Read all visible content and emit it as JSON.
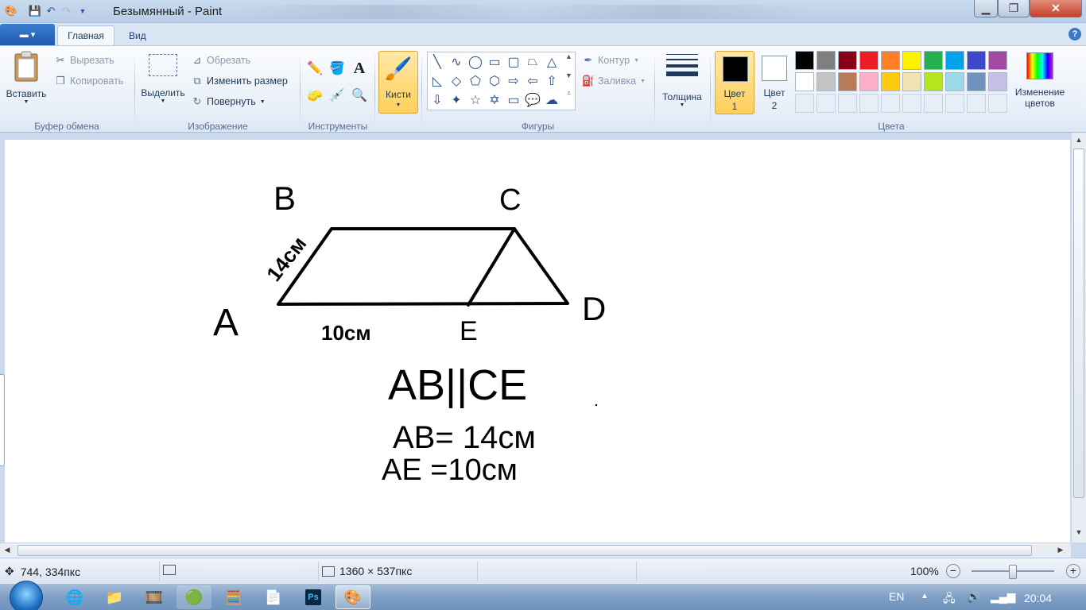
{
  "window": {
    "title": "Безымянный - Paint"
  },
  "tabs": [
    {
      "label": "Главная"
    },
    {
      "label": "Вид"
    }
  ],
  "clipboard": {
    "paste": "Вставить",
    "cut": "Вырезать",
    "copy": "Копировать",
    "group": "Буфер обмена"
  },
  "image": {
    "select": "Выделить",
    "crop": "Обрезать",
    "resize": "Изменить размер",
    "rotate": "Повернуть",
    "group": "Изображение"
  },
  "tools": {
    "group": "Инструменты"
  },
  "brushes": {
    "label": "Кисти"
  },
  "shapes": {
    "outline": "Контур",
    "fill": "Заливка",
    "group": "Фигуры"
  },
  "size": {
    "label": "Толщина"
  },
  "colors": {
    "color1": "Цвет",
    "color1_num": "1",
    "color2": "Цвет",
    "color2_num": "2",
    "edit1": "Изменение",
    "edit2": "цветов",
    "group": "Цвета",
    "color1_value": "#000000",
    "color2_value": "#ffffff",
    "palette_row1": [
      "#000000",
      "#7f7f7f",
      "#880015",
      "#ed1c24",
      "#ff7f27",
      "#fff200",
      "#22b14c",
      "#00a2e8",
      "#3f48cc",
      "#a349a4"
    ],
    "palette_row2": [
      "#ffffff",
      "#c3c3c3",
      "#b97a57",
      "#ffaec9",
      "#ffc90e",
      "#efe4b0",
      "#b5e61d",
      "#99d9ea",
      "#7092be",
      "#c8bfe7"
    ]
  },
  "drawing": {
    "label_a": "A",
    "label_b": "B",
    "label_c": "C",
    "label_d": "D",
    "label_e": "E",
    "side_ab": "14см",
    "side_ae": "10см",
    "note_parallel": "AB||CE",
    "note_ab": "AB= 14см",
    "note_ae": "AE =10см"
  },
  "status": {
    "cursor": "744, 334пкс",
    "canvas_size": "1360 × 537пкс",
    "zoom": "100%",
    "zoom_level": 1.0
  },
  "taskbar": {
    "lang": "EN",
    "time": "20:04"
  }
}
